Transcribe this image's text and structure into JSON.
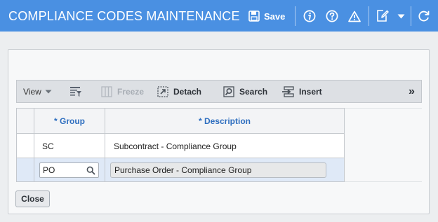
{
  "window": {
    "title": "COMPLIANCE CODES MAINTENANCE",
    "save_label": "Save",
    "icons": [
      "save-icon",
      "info-icon",
      "help-icon",
      "warning-icon",
      "edit-icon",
      "chevron-down-icon",
      "refresh-icon"
    ]
  },
  "toolbar": {
    "view_label": "View",
    "freeze_label": "Freeze",
    "detach_label": "Detach",
    "search_label": "Search",
    "insert_label": "Insert",
    "more_label": "»"
  },
  "grid": {
    "columns": [
      "* Group",
      "* Description"
    ],
    "rows": [
      {
        "group": "SC",
        "description": "Subcontract - Compliance Group"
      },
      {
        "group": "PO",
        "description": "Purchase Order - Compliance Group"
      }
    ]
  },
  "footer": {
    "close_label": "Close"
  },
  "colors": {
    "header": "#4a90e2",
    "column_header_text": "#2f6fc0",
    "selected_row": "#dfe9f7"
  }
}
